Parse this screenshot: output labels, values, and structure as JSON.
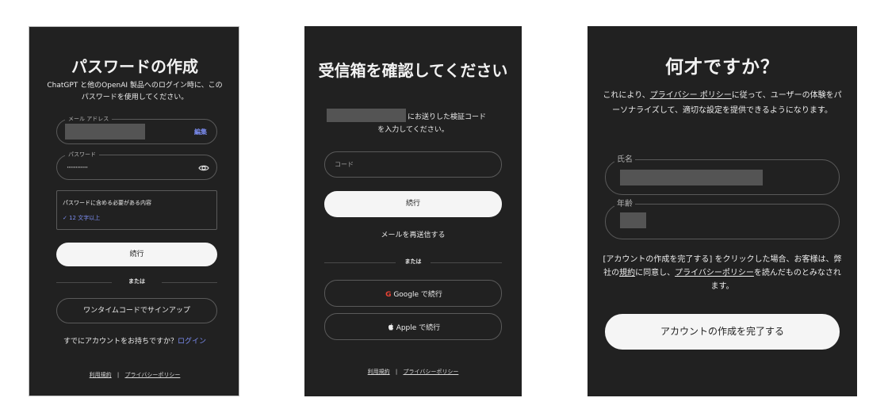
{
  "password_screen": {
    "title": "パスワードの作成",
    "subtitle": "ChatGPT と他のOpenAI 製品へのログイン時に、このパスワードを使用してください。",
    "email_label": "メール アドレス",
    "edit_label": "編集",
    "password_label": "パスワード",
    "password_mask": "··············",
    "requirements_title": "パスワードに含める必要がある内容",
    "requirement_item": "✓ 12 文字以上",
    "continue_label": "続行",
    "or_label": "または",
    "otp_signup_label": "ワンタイムコードでサインアップ",
    "have_account_text": "すでにアカウントをお持ちですか？",
    "login_link": "ログイン",
    "terms_link": "利用規約",
    "separator": "|",
    "privacy_link": "プライバシーポリシー"
  },
  "verify_screen": {
    "title": "受信箱を確認してください",
    "sent_text": "にお送りした検証コード",
    "enter_text": "を入力してください。",
    "code_placeholder": "コード",
    "continue_label": "続行",
    "resend_label": "メールを再送信する",
    "or_label": "または",
    "google_label": "Google で続行",
    "apple_label": "Apple で続行",
    "terms_link": "利用規約",
    "separator": "|",
    "privacy_link": "プライバシーポリシー"
  },
  "age_screen": {
    "title": "何才ですか？",
    "sub_before": "これにより、",
    "sub_link": "プライバシー ポリシー",
    "sub_after": "に従って、ユーザーの体験をパーソナライズして、適切な設定を提供できるようになります。",
    "name_label": "氏名",
    "age_label": "年齢",
    "consent_1": "[アカウントの作成を完了する] をクリックした場合、お客様は、弊社の",
    "consent_terms": "規約",
    "consent_2": "に同意し、",
    "consent_privacy": "プライバシーポリシー",
    "consent_3": "を読んだものとみなされます。",
    "complete_label": "アカウントの作成を完了する"
  },
  "colors": {
    "panel_bg": "#212121",
    "link_blue": "#7b8cf0",
    "button_white": "#f5f5f5"
  }
}
